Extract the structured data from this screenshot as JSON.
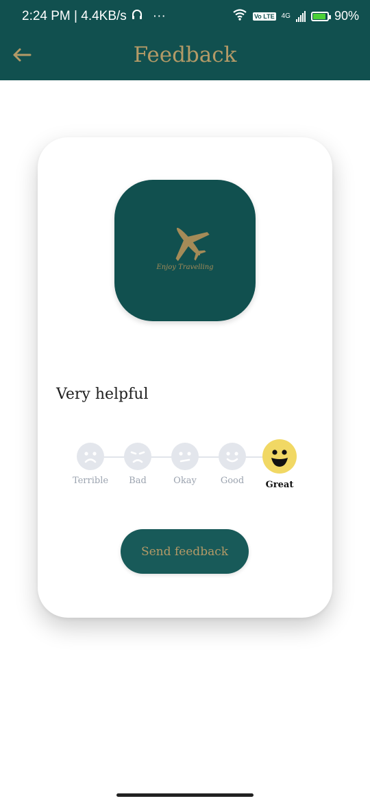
{
  "status_bar": {
    "time_speed": "2:24 PM | 4.4KB/s",
    "dots": "···",
    "volte_badge": "Vo LTE",
    "network_label": "4G",
    "battery_text": "90%",
    "battery_level": 0.9,
    "icons": [
      "headphones-icon",
      "wifi-icon",
      "signal-icon",
      "battery-icon"
    ]
  },
  "appbar": {
    "title": "Feedback",
    "back_icon": "back-arrow-icon",
    "background_color": "#11504f",
    "accent_color": "#b49a67"
  },
  "logo": {
    "caption": "Enjoy Travelling",
    "icon": "airplane-icon"
  },
  "rating": {
    "selected_text": "Very helpful",
    "options": [
      {
        "label": "Terrible"
      },
      {
        "label": "Bad"
      },
      {
        "label": "Okay"
      },
      {
        "label": "Good"
      },
      {
        "label": "Great"
      }
    ],
    "selected_index": 4
  },
  "send_button": {
    "label": "Send feedback"
  }
}
